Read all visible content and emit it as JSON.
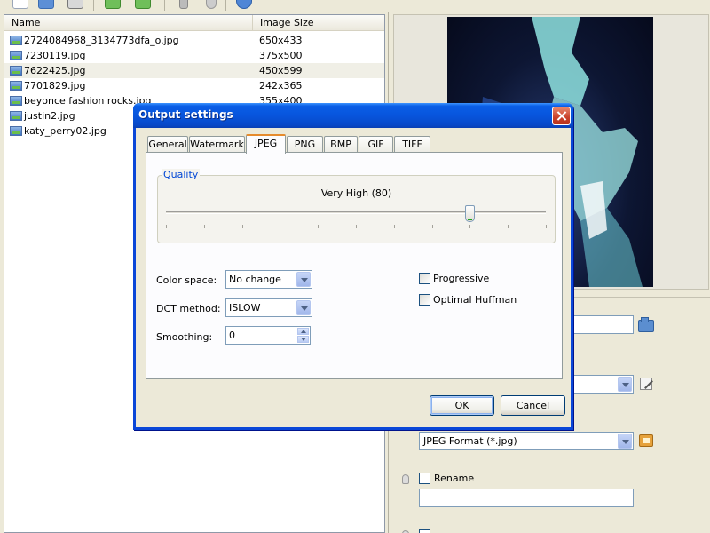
{
  "file_list": {
    "columns": [
      "Name",
      "Image Size"
    ],
    "files": [
      {
        "name": "2724084968_3134773dfa_o.jpg",
        "size": "650x433"
      },
      {
        "name": "7230119.jpg",
        "size": "375x500"
      },
      {
        "name": "7622425.jpg",
        "size": "450x599"
      },
      {
        "name": "7701829.jpg",
        "size": "242x365"
      },
      {
        "name": "beyonce fashion rocks.jpg",
        "size": "355x400"
      },
      {
        "name": "justin2.jpg",
        "size": ""
      },
      {
        "name": "katy_perry02.jpg",
        "size": ""
      }
    ]
  },
  "right_panel": {
    "format_select": "JPEG Format (*.jpg)",
    "rename_label": "Rename"
  },
  "dialog": {
    "title": "Output settings",
    "tabs": [
      "General",
      "Watermark",
      "JPEG",
      "PNG",
      "BMP",
      "GIF",
      "TIFF"
    ],
    "active_tab": "JPEG",
    "quality_group_title": "Quality",
    "quality_label": "Very High (80)",
    "quality_value": 80,
    "color_space_label": "Color space:",
    "color_space_value": "No change",
    "dct_method_label": "DCT method:",
    "dct_method_value": "ISLOW",
    "smoothing_label": "Smoothing:",
    "smoothing_value": "0",
    "progressive_label": "Progressive",
    "optimal_huffman_label": "Optimal Huffman",
    "ok_label": "OK",
    "cancel_label": "Cancel"
  },
  "colors": {
    "titlebar": "#0855dd",
    "tab_highlight": "#e68b2c",
    "group_title": "#0046d5"
  }
}
